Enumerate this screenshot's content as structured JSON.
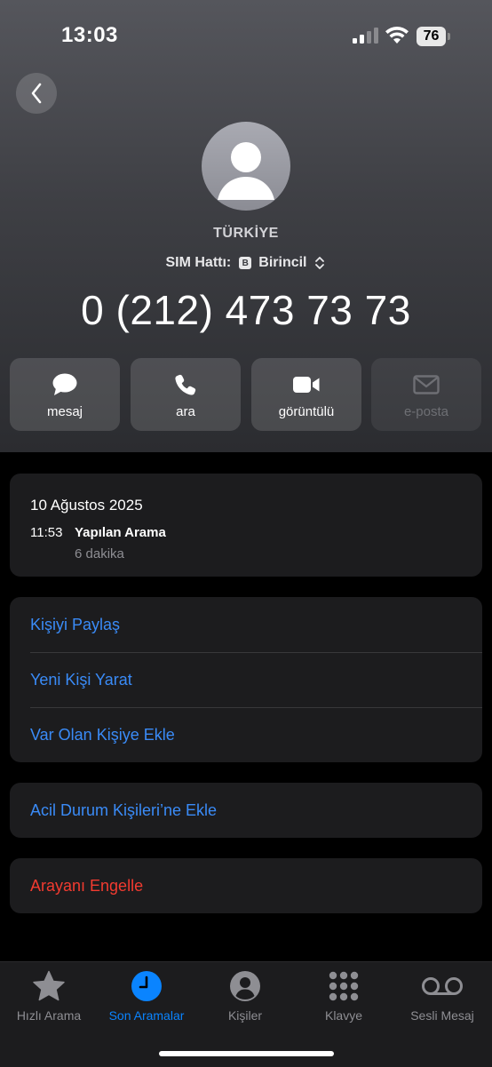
{
  "status_bar": {
    "time": "13:03",
    "battery_level": "76"
  },
  "contact": {
    "name": "TÜRKİYE",
    "sim_label": "SIM Hattı:",
    "sim_badge": "B",
    "sim_value": "Birincil",
    "phone_number": "0 (212) 473 73 73"
  },
  "actions": [
    {
      "label": "mesaj",
      "icon": "message-bubble-icon",
      "enabled": true
    },
    {
      "label": "ara",
      "icon": "phone-icon",
      "enabled": true
    },
    {
      "label": "görüntülü",
      "icon": "video-camera-icon",
      "enabled": true
    },
    {
      "label": "e-posta",
      "icon": "envelope-icon",
      "enabled": false
    }
  ],
  "recent": {
    "date": "10 Ağustos 2025",
    "time": "11:53",
    "type": "Yapılan Arama",
    "duration": "6 dakika"
  },
  "options": [
    "Kişiyi Paylaş",
    "Yeni Kişi Yarat",
    "Var Olan Kişiye Ekle"
  ],
  "emergency_label": "Acil Durum Kişileri’ne Ekle",
  "block_label": "Arayanı Engelle",
  "tabs": [
    {
      "label": "Hızlı Arama",
      "icon": "star-icon",
      "active": false
    },
    {
      "label": "Son Aramalar",
      "icon": "clock-icon",
      "active": true
    },
    {
      "label": "Kişiler",
      "icon": "person-circle-icon",
      "active": false
    },
    {
      "label": "Klavye",
      "icon": "keypad-icon",
      "active": false
    },
    {
      "label": "Sesli Mesaj",
      "icon": "voicemail-icon",
      "active": false
    }
  ],
  "colors": {
    "accent": "#0a84ff",
    "link": "#3a8bf7",
    "destructive": "#f23b30",
    "card_background": "#1c1c1e"
  }
}
